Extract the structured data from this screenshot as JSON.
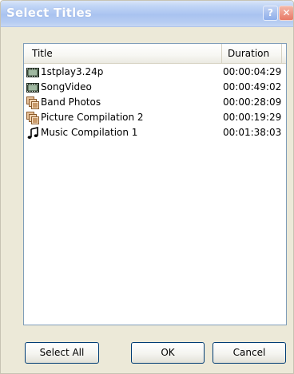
{
  "window": {
    "title": "Select Titles",
    "help_glyph": "?",
    "close_glyph": "✕"
  },
  "table": {
    "columns": [
      "Title",
      "Duration"
    ],
    "rows": [
      {
        "icon": "film-icon",
        "title": "1stplay3.24p",
        "duration": "00:00:04:29"
      },
      {
        "icon": "film-icon",
        "title": "SongVideo",
        "duration": "00:00:49:02"
      },
      {
        "icon": "photos-icon",
        "title": "Band Photos",
        "duration": "00:00:28:09"
      },
      {
        "icon": "photos-icon",
        "title": "Picture Compilation 2",
        "duration": "00:00:19:29"
      },
      {
        "icon": "music-note-icon",
        "title": "Music Compilation 1",
        "duration": "00:01:38:03"
      }
    ]
  },
  "buttons": {
    "select_all": "Select All",
    "ok": "OK",
    "cancel": "Cancel"
  }
}
